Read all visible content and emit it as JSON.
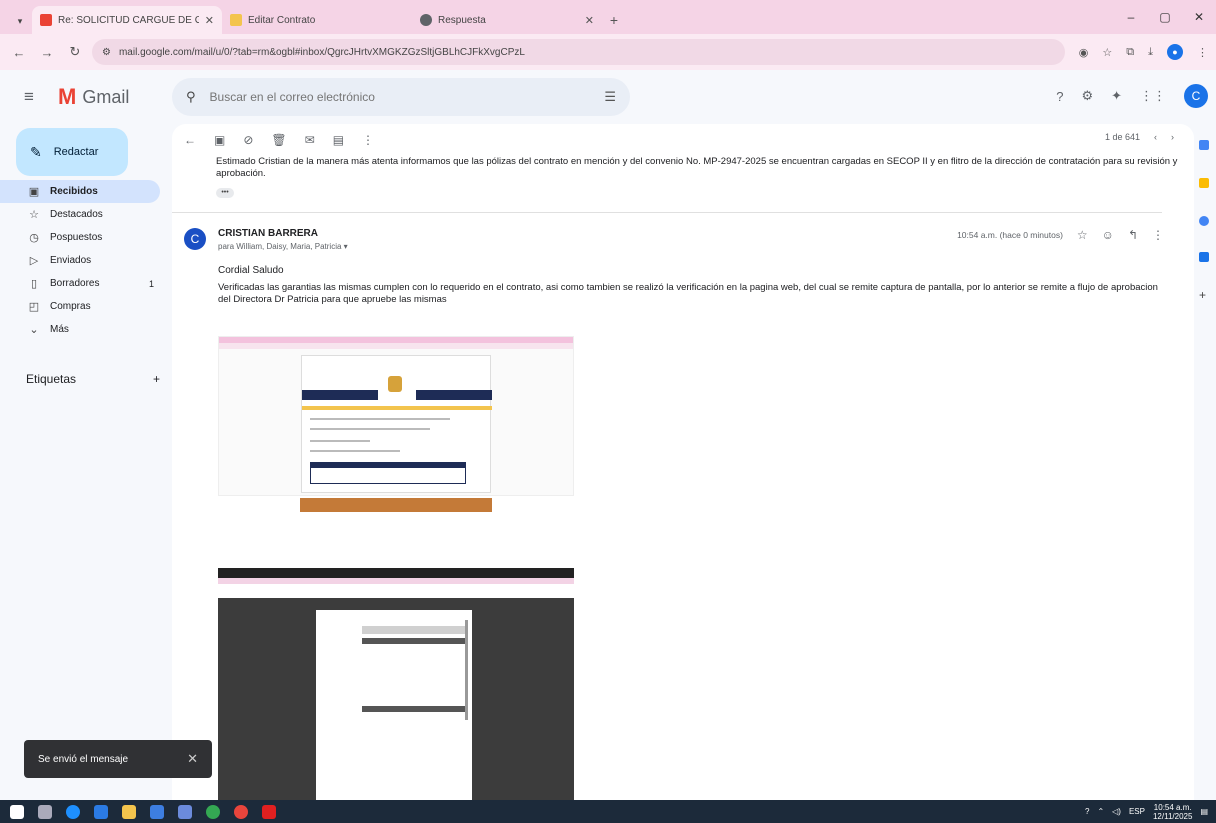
{
  "browser": {
    "tabs": [
      {
        "title": "Re: SOLICITUD CARGUE DE GA",
        "close": "✕",
        "color": "#ea4335"
      },
      {
        "title": "Editar Contrato",
        "close": "",
        "color": "#f3c44d"
      },
      {
        "title": "Respuesta",
        "close": "✕",
        "color": "#5f6368"
      }
    ],
    "new_tab": "+",
    "url": "mail.google.com/mail/u/0/?tab=rm&ogbl#inbox/QgrcJHrtvXMGKZGzSltjGBLhCJFkXvgCPzL",
    "window_controls": [
      "–",
      "▢",
      "✕"
    ]
  },
  "gmail": {
    "logo_text": "Gmail",
    "search_placeholder": "Buscar en el correo electrónico",
    "account_initial": "C",
    "compose_label": "Redactar",
    "nav": [
      {
        "label": "Recibidos",
        "icon": "inbox-icon",
        "glyph": "▣",
        "count": "",
        "active": true
      },
      {
        "label": "Destacados",
        "icon": "star-icon",
        "glyph": "☆",
        "count": "",
        "active": false
      },
      {
        "label": "Pospuestos",
        "icon": "clock-icon",
        "glyph": "◷",
        "count": "",
        "active": false
      },
      {
        "label": "Enviados",
        "icon": "send-icon",
        "glyph": "▷",
        "count": "",
        "active": false
      },
      {
        "label": "Borradores",
        "icon": "draft-icon",
        "glyph": "▯",
        "count": "1",
        "active": false
      },
      {
        "label": "Compras",
        "icon": "shopping-icon",
        "glyph": "◰",
        "count": "",
        "active": false
      },
      {
        "label": "Más",
        "icon": "chevron-down-icon",
        "glyph": "⌄",
        "count": "",
        "active": false
      }
    ],
    "labels_title": "Etiquetas",
    "labels_add": "+",
    "pager": "1 de 641",
    "previous_message": "Estimado Cristian de la manera más atenta informamos que las pólizas del contrato en mención y del convenio No. MP-2947-2025 se encuentran cargadas en SECOP II y en flitro de la dirección de contratación para su revisión y aprobación.",
    "message": {
      "avatar": "C",
      "sender": "CRISTIAN BARRERA",
      "recipients": "para William, Daisy, Maria, Patricia ▾",
      "time": "10:54 a.m. (hace 0 minutos)",
      "greeting": "Cordial Saludo",
      "body": "Verificadas las garantias las mismas cumplen con lo requerido en el contrato, asi como tambien se realizó la verificación en la pagina web, del cual se remite captura de pantalla, por lo anterior se remite a flujo de aprobacion del Directora Dr Patricia para que apruebe las mismas"
    },
    "toast": {
      "text": "Se envió el mensaje",
      "close": "✕"
    }
  },
  "taskbar": {
    "lang": "ESP",
    "time": "10:54 a.m.",
    "date": "12/11/2025"
  },
  "colors": {
    "tab_strip": "#f5d4e6",
    "compose": "#c2e7ff",
    "active_nav": "#d3e3fd",
    "avatar": "#1a4fc4"
  }
}
